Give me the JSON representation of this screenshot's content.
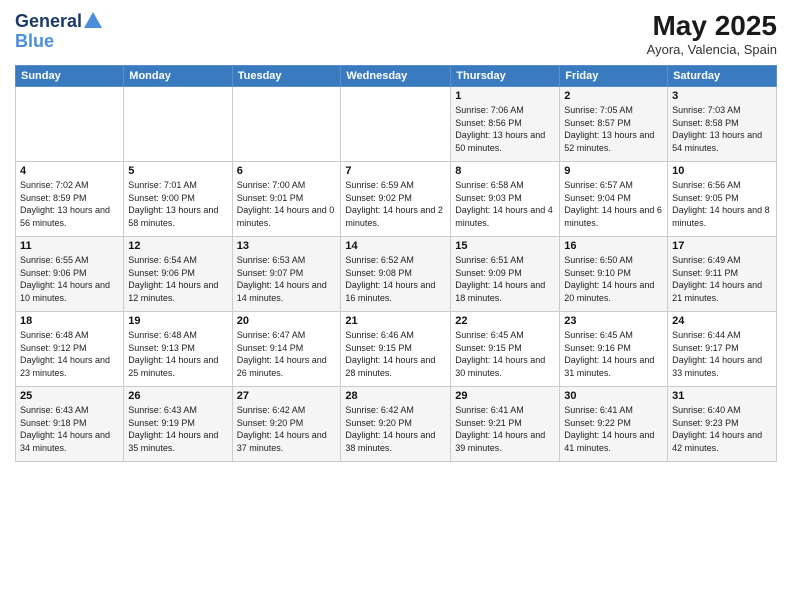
{
  "header": {
    "logo_line1": "General",
    "logo_line2": "Blue",
    "month": "May 2025",
    "location": "Ayora, Valencia, Spain"
  },
  "weekdays": [
    "Sunday",
    "Monday",
    "Tuesday",
    "Wednesday",
    "Thursday",
    "Friday",
    "Saturday"
  ],
  "weeks": [
    [
      {
        "day": "",
        "info": ""
      },
      {
        "day": "",
        "info": ""
      },
      {
        "day": "",
        "info": ""
      },
      {
        "day": "",
        "info": ""
      },
      {
        "day": "1",
        "info": "Sunrise: 7:06 AM\nSunset: 8:56 PM\nDaylight: 13 hours\nand 50 minutes."
      },
      {
        "day": "2",
        "info": "Sunrise: 7:05 AM\nSunset: 8:57 PM\nDaylight: 13 hours\nand 52 minutes."
      },
      {
        "day": "3",
        "info": "Sunrise: 7:03 AM\nSunset: 8:58 PM\nDaylight: 13 hours\nand 54 minutes."
      }
    ],
    [
      {
        "day": "4",
        "info": "Sunrise: 7:02 AM\nSunset: 8:59 PM\nDaylight: 13 hours\nand 56 minutes."
      },
      {
        "day": "5",
        "info": "Sunrise: 7:01 AM\nSunset: 9:00 PM\nDaylight: 13 hours\nand 58 minutes."
      },
      {
        "day": "6",
        "info": "Sunrise: 7:00 AM\nSunset: 9:01 PM\nDaylight: 14 hours\nand 0 minutes."
      },
      {
        "day": "7",
        "info": "Sunrise: 6:59 AM\nSunset: 9:02 PM\nDaylight: 14 hours\nand 2 minutes."
      },
      {
        "day": "8",
        "info": "Sunrise: 6:58 AM\nSunset: 9:03 PM\nDaylight: 14 hours\nand 4 minutes."
      },
      {
        "day": "9",
        "info": "Sunrise: 6:57 AM\nSunset: 9:04 PM\nDaylight: 14 hours\nand 6 minutes."
      },
      {
        "day": "10",
        "info": "Sunrise: 6:56 AM\nSunset: 9:05 PM\nDaylight: 14 hours\nand 8 minutes."
      }
    ],
    [
      {
        "day": "11",
        "info": "Sunrise: 6:55 AM\nSunset: 9:06 PM\nDaylight: 14 hours\nand 10 minutes."
      },
      {
        "day": "12",
        "info": "Sunrise: 6:54 AM\nSunset: 9:06 PM\nDaylight: 14 hours\nand 12 minutes."
      },
      {
        "day": "13",
        "info": "Sunrise: 6:53 AM\nSunset: 9:07 PM\nDaylight: 14 hours\nand 14 minutes."
      },
      {
        "day": "14",
        "info": "Sunrise: 6:52 AM\nSunset: 9:08 PM\nDaylight: 14 hours\nand 16 minutes."
      },
      {
        "day": "15",
        "info": "Sunrise: 6:51 AM\nSunset: 9:09 PM\nDaylight: 14 hours\nand 18 minutes."
      },
      {
        "day": "16",
        "info": "Sunrise: 6:50 AM\nSunset: 9:10 PM\nDaylight: 14 hours\nand 20 minutes."
      },
      {
        "day": "17",
        "info": "Sunrise: 6:49 AM\nSunset: 9:11 PM\nDaylight: 14 hours\nand 21 minutes."
      }
    ],
    [
      {
        "day": "18",
        "info": "Sunrise: 6:48 AM\nSunset: 9:12 PM\nDaylight: 14 hours\nand 23 minutes."
      },
      {
        "day": "19",
        "info": "Sunrise: 6:48 AM\nSunset: 9:13 PM\nDaylight: 14 hours\nand 25 minutes."
      },
      {
        "day": "20",
        "info": "Sunrise: 6:47 AM\nSunset: 9:14 PM\nDaylight: 14 hours\nand 26 minutes."
      },
      {
        "day": "21",
        "info": "Sunrise: 6:46 AM\nSunset: 9:15 PM\nDaylight: 14 hours\nand 28 minutes."
      },
      {
        "day": "22",
        "info": "Sunrise: 6:45 AM\nSunset: 9:15 PM\nDaylight: 14 hours\nand 30 minutes."
      },
      {
        "day": "23",
        "info": "Sunrise: 6:45 AM\nSunset: 9:16 PM\nDaylight: 14 hours\nand 31 minutes."
      },
      {
        "day": "24",
        "info": "Sunrise: 6:44 AM\nSunset: 9:17 PM\nDaylight: 14 hours\nand 33 minutes."
      }
    ],
    [
      {
        "day": "25",
        "info": "Sunrise: 6:43 AM\nSunset: 9:18 PM\nDaylight: 14 hours\nand 34 minutes."
      },
      {
        "day": "26",
        "info": "Sunrise: 6:43 AM\nSunset: 9:19 PM\nDaylight: 14 hours\nand 35 minutes."
      },
      {
        "day": "27",
        "info": "Sunrise: 6:42 AM\nSunset: 9:20 PM\nDaylight: 14 hours\nand 37 minutes."
      },
      {
        "day": "28",
        "info": "Sunrise: 6:42 AM\nSunset: 9:20 PM\nDaylight: 14 hours\nand 38 minutes."
      },
      {
        "day": "29",
        "info": "Sunrise: 6:41 AM\nSunset: 9:21 PM\nDaylight: 14 hours\nand 39 minutes."
      },
      {
        "day": "30",
        "info": "Sunrise: 6:41 AM\nSunset: 9:22 PM\nDaylight: 14 hours\nand 41 minutes."
      },
      {
        "day": "31",
        "info": "Sunrise: 6:40 AM\nSunset: 9:23 PM\nDaylight: 14 hours\nand 42 minutes."
      }
    ]
  ]
}
